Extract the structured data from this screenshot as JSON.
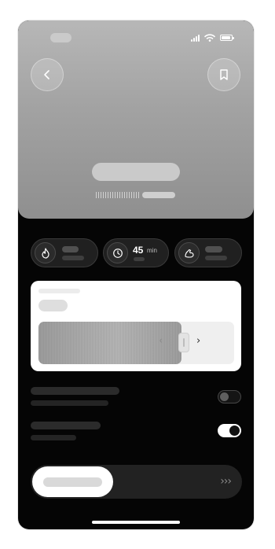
{
  "status_bar": {
    "icons": [
      "cellular-signal-icon",
      "wifi-icon",
      "battery-icon"
    ]
  },
  "hero": {
    "buttons": [
      "back-chevron-icon",
      "bookmark-icon"
    ]
  },
  "stats": [
    {
      "icon": "flame-icon",
      "value": "",
      "unit": ""
    },
    {
      "icon": "clock-icon",
      "value": "45",
      "unit": "min"
    },
    {
      "icon": "flexed-arm-icon",
      "value": "",
      "unit": ""
    }
  ],
  "selector_card": {
    "left_arrow": "‹",
    "right_arrow": "›"
  },
  "settings": [
    {
      "toggle_on": false
    },
    {
      "toggle_on": true
    }
  ],
  "start_slider": {
    "chevrons": "›››"
  },
  "colors": {
    "background": "#050505",
    "hero_gray": "#a2a2a2",
    "toggle_on": "#ffffff",
    "card": "#ffffff"
  }
}
